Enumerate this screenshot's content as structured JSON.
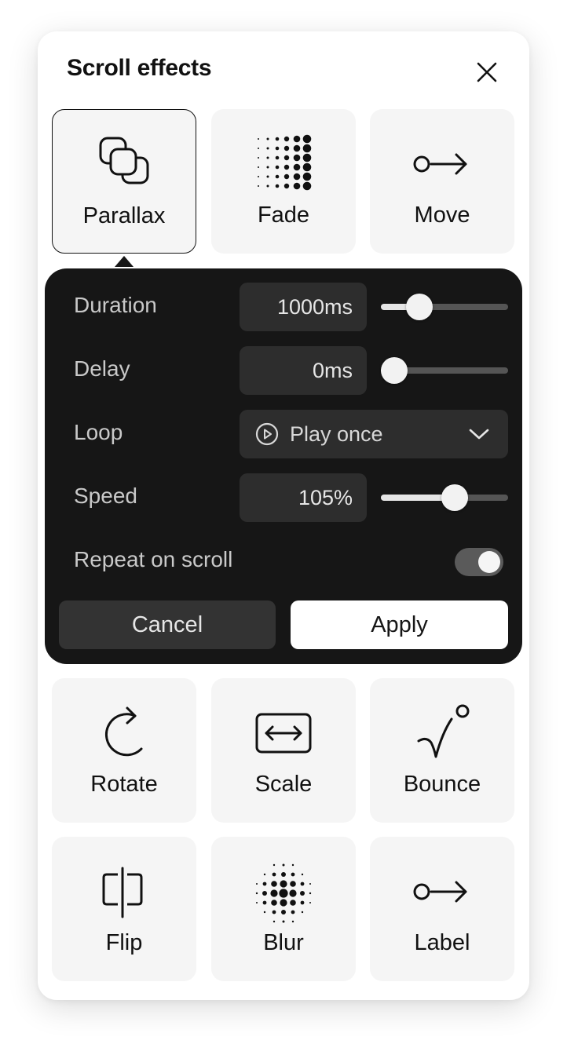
{
  "title": "Scroll effects",
  "effects_top": [
    {
      "label": "Parallax",
      "icon": "parallax-icon",
      "selected": true
    },
    {
      "label": "Fade",
      "icon": "fade-dots-icon",
      "selected": false
    },
    {
      "label": "Move",
      "icon": "move-arrow-icon",
      "selected": false
    }
  ],
  "settings": {
    "duration": {
      "label": "Duration",
      "value": "1000ms",
      "slider_fraction": 0.25
    },
    "delay": {
      "label": "Delay",
      "value": "0ms",
      "slider_fraction": 0.0
    },
    "loop": {
      "label": "Loop",
      "value": "Play once",
      "icon": "play-circle-icon"
    },
    "speed": {
      "label": "Speed",
      "value": "105%",
      "slider_fraction": 0.6
    },
    "repeat": {
      "label": "Repeat on scroll",
      "enabled": true
    },
    "cancel_label": "Cancel",
    "apply_label": "Apply"
  },
  "effects_bottom": [
    {
      "label": "Rotate",
      "icon": "rotate-icon"
    },
    {
      "label": "Scale",
      "icon": "scale-icon"
    },
    {
      "label": "Bounce",
      "icon": "bounce-icon"
    },
    {
      "label": "Flip",
      "icon": "flip-icon"
    },
    {
      "label": "Blur",
      "icon": "blur-dots-icon"
    },
    {
      "label": "Label",
      "icon": "label-arrow-icon"
    }
  ],
  "colors": {
    "panel_bg": "#ffffff",
    "tile_bg": "#f5f5f5",
    "settings_bg": "#161616",
    "field_bg": "#2d2d2d",
    "text_dark": "#111111",
    "text_light": "#e6e6e6"
  }
}
